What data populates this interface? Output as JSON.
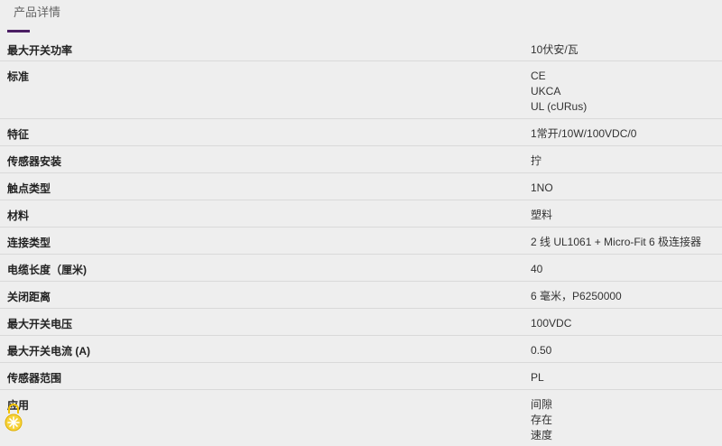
{
  "header": {
    "tab_label": "产品详情",
    "accent_color": "#4b1e63"
  },
  "specs": [
    {
      "label": "最大开关功率",
      "values": [
        "10伏安/瓦"
      ]
    },
    {
      "label": "标准",
      "values": [
        "CE",
        "UKCA",
        "UL (cURus)"
      ]
    },
    {
      "label": "特征",
      "values": [
        "1常开/10W/100VDC/0"
      ]
    },
    {
      "label": "传感器安装",
      "values": [
        "拧"
      ]
    },
    {
      "label": "触点类型",
      "values": [
        "1NO"
      ]
    },
    {
      "label": "材料",
      "values": [
        "塑料"
      ]
    },
    {
      "label": "连接类型",
      "values": [
        "2 线 UL1061 + Micro-Fit 6 极连接器"
      ]
    },
    {
      "label": "电缆长度（厘米)",
      "values": [
        "40"
      ]
    },
    {
      "label": "关闭距离",
      "values": [
        "6 毫米，P6250000"
      ]
    },
    {
      "label": "最大开关电压",
      "values": [
        "100VDC"
      ]
    },
    {
      "label": "最大开关电流 (A)",
      "values": [
        "0.50"
      ]
    },
    {
      "label": "传感器范围",
      "values": [
        "PL"
      ]
    },
    {
      "label": "应用",
      "values": [
        "间隙",
        "存在",
        "速度"
      ]
    }
  ],
  "widget": {
    "icon": "lock-sun-icon",
    "color": "#f2c200"
  }
}
